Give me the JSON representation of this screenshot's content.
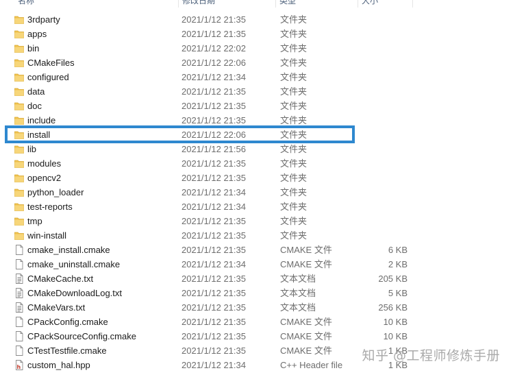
{
  "header": {
    "name": "名称",
    "date": "修改日期",
    "type": "类型",
    "size": "大小"
  },
  "files": [
    {
      "name": "3rdparty",
      "date": "2021/1/12 21:35",
      "type": "文件夹",
      "size": "",
      "kind": "folder"
    },
    {
      "name": "apps",
      "date": "2021/1/12 21:35",
      "type": "文件夹",
      "size": "",
      "kind": "folder"
    },
    {
      "name": "bin",
      "date": "2021/1/12 22:02",
      "type": "文件夹",
      "size": "",
      "kind": "folder"
    },
    {
      "name": "CMakeFiles",
      "date": "2021/1/12 22:06",
      "type": "文件夹",
      "size": "",
      "kind": "folder"
    },
    {
      "name": "configured",
      "date": "2021/1/12 21:34",
      "type": "文件夹",
      "size": "",
      "kind": "folder"
    },
    {
      "name": "data",
      "date": "2021/1/12 21:35",
      "type": "文件夹",
      "size": "",
      "kind": "folder"
    },
    {
      "name": "doc",
      "date": "2021/1/12 21:35",
      "type": "文件夹",
      "size": "",
      "kind": "folder"
    },
    {
      "name": "include",
      "date": "2021/1/12 21:35",
      "type": "文件夹",
      "size": "",
      "kind": "folder"
    },
    {
      "name": "install",
      "date": "2021/1/12 22:06",
      "type": "文件夹",
      "size": "",
      "kind": "folder"
    },
    {
      "name": "lib",
      "date": "2021/1/12 21:56",
      "type": "文件夹",
      "size": "",
      "kind": "folder"
    },
    {
      "name": "modules",
      "date": "2021/1/12 21:35",
      "type": "文件夹",
      "size": "",
      "kind": "folder"
    },
    {
      "name": "opencv2",
      "date": "2021/1/12 21:35",
      "type": "文件夹",
      "size": "",
      "kind": "folder"
    },
    {
      "name": "python_loader",
      "date": "2021/1/12 21:34",
      "type": "文件夹",
      "size": "",
      "kind": "folder"
    },
    {
      "name": "test-reports",
      "date": "2021/1/12 21:34",
      "type": "文件夹",
      "size": "",
      "kind": "folder"
    },
    {
      "name": "tmp",
      "date": "2021/1/12 21:35",
      "type": "文件夹",
      "size": "",
      "kind": "folder"
    },
    {
      "name": "win-install",
      "date": "2021/1/12 21:35",
      "type": "文件夹",
      "size": "",
      "kind": "folder"
    },
    {
      "name": "cmake_install.cmake",
      "date": "2021/1/12 21:35",
      "type": "CMAKE 文件",
      "size": "6 KB",
      "kind": "file"
    },
    {
      "name": "cmake_uninstall.cmake",
      "date": "2021/1/12 21:34",
      "type": "CMAKE 文件",
      "size": "2 KB",
      "kind": "file"
    },
    {
      "name": "CMakeCache.txt",
      "date": "2021/1/12 21:35",
      "type": "文本文档",
      "size": "205 KB",
      "kind": "text"
    },
    {
      "name": "CMakeDownloadLog.txt",
      "date": "2021/1/12 21:35",
      "type": "文本文档",
      "size": "5 KB",
      "kind": "text"
    },
    {
      "name": "CMakeVars.txt",
      "date": "2021/1/12 21:35",
      "type": "文本文档",
      "size": "256 KB",
      "kind": "text"
    },
    {
      "name": "CPackConfig.cmake",
      "date": "2021/1/12 21:35",
      "type": "CMAKE 文件",
      "size": "10 KB",
      "kind": "file"
    },
    {
      "name": "CPackSourceConfig.cmake",
      "date": "2021/1/12 21:35",
      "type": "CMAKE 文件",
      "size": "10 KB",
      "kind": "file"
    },
    {
      "name": "CTestTestfile.cmake",
      "date": "2021/1/12 21:35",
      "type": "CMAKE 文件",
      "size": "1 KB",
      "kind": "file"
    },
    {
      "name": "custom_hal.hpp",
      "date": "2021/1/12 21:34",
      "type": "C++ Header file",
      "size": "1 KB",
      "kind": "hpp"
    }
  ],
  "watermark": "知乎 @工程师修炼手册",
  "colors": {
    "highlight": "#2e88cf",
    "folder": "#f0c350",
    "hpp_letter": "#c0392b"
  }
}
